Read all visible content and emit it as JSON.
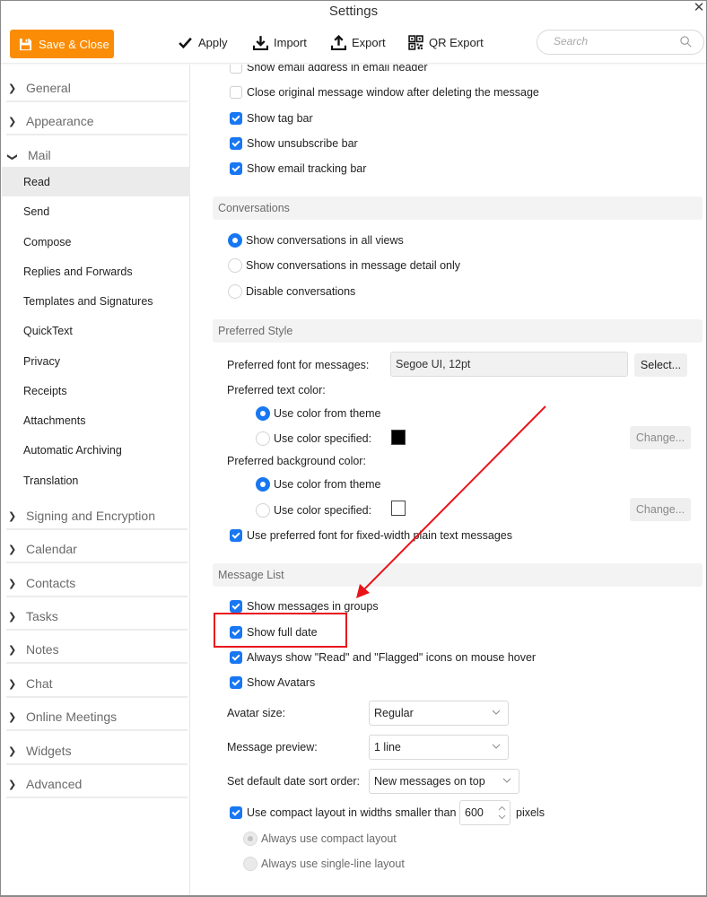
{
  "window": {
    "title": "Settings",
    "close_icon": "close-x-icon"
  },
  "toolbar": {
    "save_close": {
      "label": "Save & Close",
      "icon": "floppy-disk-icon",
      "color": "#fb8c05"
    },
    "apply": {
      "label": "Apply",
      "icon": "checkmark-icon"
    },
    "import": {
      "label": "Import",
      "icon": "download-tray-icon"
    },
    "export": {
      "label": "Export",
      "icon": "upload-tray-icon"
    },
    "qr_export": {
      "label": "QR Export",
      "icon": "qr-code-icon"
    },
    "search": {
      "placeholder": "Search",
      "value": "",
      "icon": "magnifier-icon"
    }
  },
  "sidebar": {
    "groups_top": [
      {
        "label": "General",
        "expanded": false
      },
      {
        "label": "Appearance",
        "expanded": false
      },
      {
        "label": "Mail",
        "expanded": true
      }
    ],
    "mail_items": [
      {
        "label": "Read",
        "active": true
      },
      {
        "label": "Send"
      },
      {
        "label": "Compose"
      },
      {
        "label": "Replies and Forwards"
      },
      {
        "label": "Templates and Signatures"
      },
      {
        "label": "QuickText"
      },
      {
        "label": "Privacy"
      },
      {
        "label": "Receipts"
      },
      {
        "label": "Attachments"
      },
      {
        "label": "Automatic Archiving"
      },
      {
        "label": "Translation"
      }
    ],
    "groups_bottom": [
      {
        "label": "Signing and Encryption"
      },
      {
        "label": "Calendar"
      },
      {
        "label": "Contacts"
      },
      {
        "label": "Tasks"
      },
      {
        "label": "Notes"
      },
      {
        "label": "Chat"
      },
      {
        "label": "Online Meetings"
      },
      {
        "label": "Widgets"
      },
      {
        "label": "Advanced"
      }
    ]
  },
  "read": {
    "top_checkboxes": [
      {
        "label": "Show email address in email header",
        "checked": false
      },
      {
        "label": "Close original message window after deleting the message",
        "checked": false
      },
      {
        "label": "Show tag bar",
        "checked": true
      },
      {
        "label": "Show unsubscribe bar",
        "checked": true
      },
      {
        "label": "Show email tracking bar",
        "checked": true
      }
    ],
    "conversations": {
      "header": "Conversations",
      "options": [
        {
          "label": "Show conversations in all views",
          "selected": true
        },
        {
          "label": "Show conversations in message detail only",
          "selected": false
        },
        {
          "label": "Disable conversations",
          "selected": false
        }
      ]
    },
    "preferred_style": {
      "header": "Preferred Style",
      "font_label": "Preferred font for messages:",
      "font_value": "Segoe UI, 12pt",
      "select_button": "Select...",
      "text_color_label": "Preferred text color:",
      "text_color_options": [
        {
          "label": "Use color from theme",
          "selected": true
        },
        {
          "label": "Use color specified:",
          "selected": false
        }
      ],
      "text_color_swatch": "#000000",
      "text_change_button": "Change...",
      "bg_color_label": "Preferred background color:",
      "bg_color_options": [
        {
          "label": "Use color from theme",
          "selected": true
        },
        {
          "label": "Use color specified:",
          "selected": false
        }
      ],
      "bg_color_swatch": "#ffffff",
      "bg_change_button": "Change...",
      "fixed_width": {
        "label": "Use preferred font for fixed-width plain text messages",
        "checked": true
      }
    },
    "message_list": {
      "header": "Message List",
      "checkboxes": [
        {
          "label": "Show messages in groups",
          "checked": true
        },
        {
          "label": "Show full date",
          "checked": true,
          "highlighted": true
        },
        {
          "label": "Always show \"Read\" and \"Flagged\" icons on mouse hover",
          "checked": true
        },
        {
          "label": "Show Avatars",
          "checked": true
        }
      ],
      "avatar_size": {
        "label": "Avatar size:",
        "value": "Regular"
      },
      "message_preview": {
        "label": "Message preview:",
        "value": "1 line"
      },
      "sort_order": {
        "label": "Set default date sort order:",
        "value": "New messages on top"
      },
      "compact": {
        "label": "Use compact layout in widths smaller than",
        "checked": true,
        "width_value": "600",
        "unit": "pixels",
        "options": [
          {
            "label": "Always use compact layout",
            "selected": true,
            "disabled": true
          },
          {
            "label": "Always use single-line layout",
            "selected": false,
            "disabled": true
          }
        ]
      }
    }
  },
  "annotation": {
    "color": "#e8141a",
    "target": "Show full date"
  }
}
